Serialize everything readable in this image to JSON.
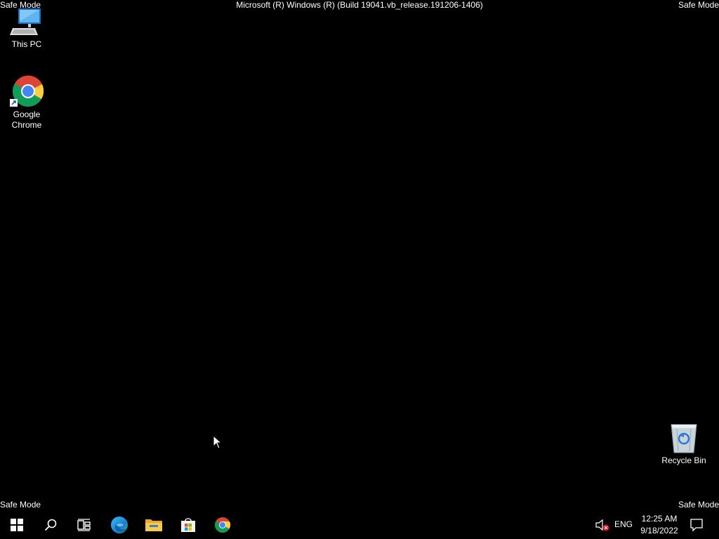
{
  "watermark": {
    "safe_mode_top_left": "Safe Mode",
    "safe_mode_top_right": "Safe Mode",
    "safe_mode_bottom_left": "Safe Mode",
    "safe_mode_bottom_right": "Safe Mode",
    "build": "Microsoft (R) Windows (R) (Build 19041.vb_release.191206-1406)"
  },
  "desktop": {
    "icons": [
      {
        "label": "This PC",
        "icon": "this-pc-icon"
      },
      {
        "label": "Google Chrome",
        "label_line1": "Google",
        "label_line2": "Chrome",
        "icon": "chrome-icon"
      },
      {
        "label": "Recycle Bin",
        "icon": "recycle-bin-icon"
      }
    ],
    "background_color": "#000000"
  },
  "taskbar": {
    "apps": [
      {
        "name": "Start",
        "icon": "windows-start-icon"
      },
      {
        "name": "Search",
        "icon": "search-icon"
      },
      {
        "name": "Task View",
        "icon": "task-view-icon"
      },
      {
        "name": "Microsoft Edge",
        "icon": "edge-icon"
      },
      {
        "name": "File Explorer",
        "icon": "file-explorer-icon"
      },
      {
        "name": "Microsoft Store",
        "icon": "store-icon"
      },
      {
        "name": "Google Chrome",
        "icon": "chrome-icon"
      }
    ],
    "tray": {
      "language": "ENG",
      "time": "12:25 AM",
      "date": "9/18/2022",
      "volume_icon": "volume-muted-icon",
      "notification_icon": "action-center-icon"
    }
  }
}
